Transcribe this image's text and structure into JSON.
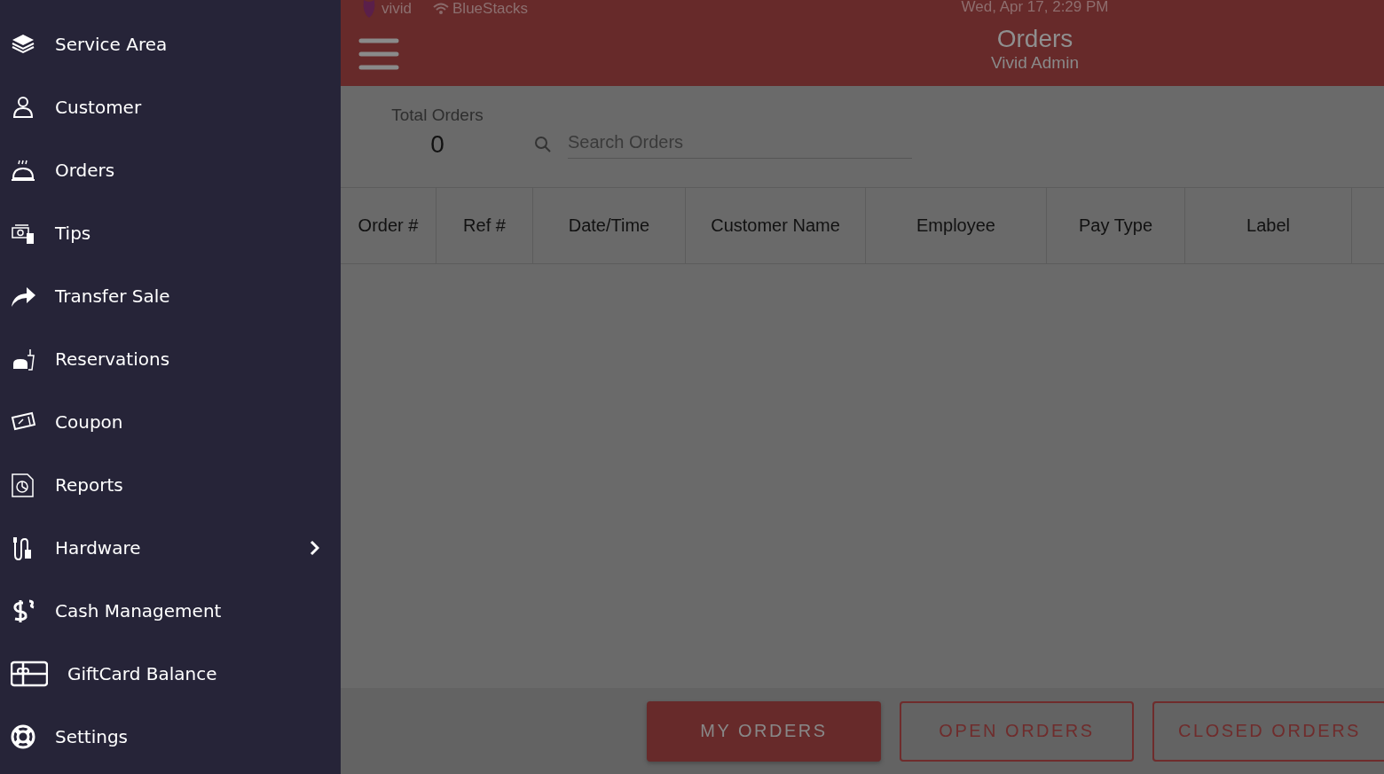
{
  "status_bar": {
    "app": "vivid",
    "network": "BlueStacks",
    "datetime": "Wed, Apr 17, 2:29 PM"
  },
  "header": {
    "title": "Orders",
    "subtitle": "Vivid Admin"
  },
  "sidebar": {
    "items": [
      {
        "label": "Service Area",
        "kind": "link"
      },
      {
        "label": "Customer",
        "kind": "link"
      },
      {
        "label": "Orders",
        "kind": "link"
      },
      {
        "label": "Tips",
        "kind": "link"
      },
      {
        "label": "Transfer Sale",
        "kind": "link"
      },
      {
        "label": "Reservations",
        "kind": "link"
      },
      {
        "label": "Coupon",
        "kind": "link"
      },
      {
        "label": "Reports",
        "kind": "link"
      },
      {
        "label": "Hardware",
        "kind": "submenu"
      },
      {
        "label": "Cash Management",
        "kind": "link"
      },
      {
        "label": "GiftCard Balance",
        "kind": "link"
      },
      {
        "label": "Settings",
        "kind": "link"
      }
    ]
  },
  "summary": {
    "label": "Total Orders",
    "count": "0"
  },
  "search": {
    "placeholder": "Search Orders"
  },
  "table": {
    "columns": [
      "Order #",
      "Ref #",
      "Date/Time",
      "Customer Name",
      "Employee",
      "Pay Type",
      "Label"
    ]
  },
  "buttons": [
    {
      "label": "MY ORDERS",
      "selected": true
    },
    {
      "label": "OPEN ORDERS",
      "selected": false
    },
    {
      "label": "CLOSED ORDERS",
      "selected": false
    }
  ]
}
